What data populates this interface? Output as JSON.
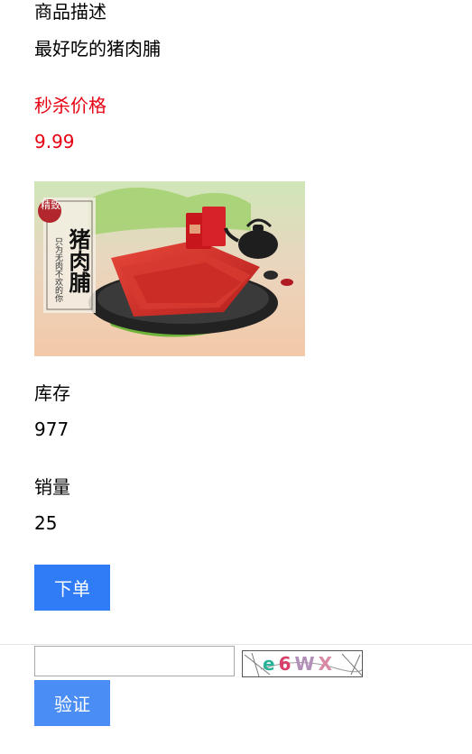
{
  "description": {
    "label": "商品描述",
    "value": "最好吃的猪肉脯"
  },
  "price": {
    "label": "秒杀价格",
    "value": "9.99",
    "color": "#e60012"
  },
  "product_image": {
    "seal_text": "精致",
    "title_text": "猪肉脯",
    "tagline_text": "只为无肉不欢的你"
  },
  "stock": {
    "label": "库存",
    "value": "977"
  },
  "sales": {
    "label": "销量",
    "value": "25"
  },
  "order_button": {
    "label": "下单",
    "color": "#2f7cf6"
  },
  "captcha": {
    "input_value": "",
    "image_text": "e6WX",
    "verify_label": "验证"
  }
}
